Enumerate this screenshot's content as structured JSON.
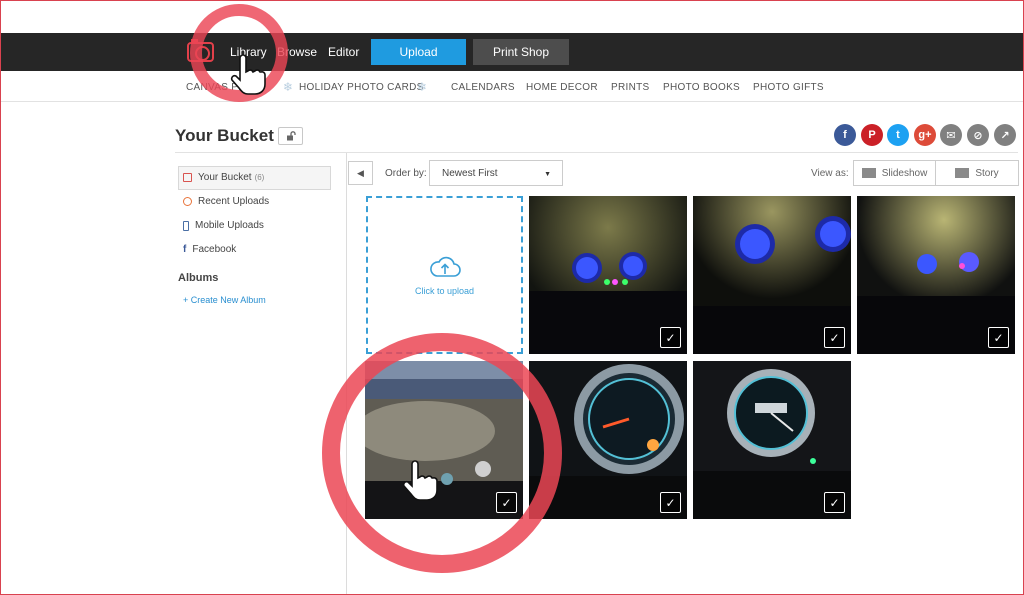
{
  "nav": {
    "items": [
      "Library",
      "Browse",
      "Editor"
    ],
    "upload_label": "Upload",
    "printshop_label": "Print Shop"
  },
  "subnav": {
    "canvas": "CANVAS PR",
    "holiday": "HOLIDAY PHOTO CARDS",
    "calendars": "CALENDARS",
    "home_decor": "HOME DECOR",
    "prints": "PRINTS",
    "photo_books": "PHOTO BOOKS",
    "photo_gifts": "PHOTO GIFTS"
  },
  "page": {
    "title": "Your Bucket"
  },
  "share": {
    "facebook": "f",
    "pinterest": "P",
    "twitter": "t",
    "googleplus": "g+",
    "email": "✉",
    "link": "⊘",
    "share": "↗"
  },
  "sidebar": {
    "items": [
      {
        "label": "Your Bucket",
        "count": "(6)"
      },
      {
        "label": "Recent Uploads"
      },
      {
        "label": "Mobile Uploads"
      },
      {
        "label": "Facebook"
      }
    ],
    "albums_title": "Albums",
    "create_album": "+ Create New Album"
  },
  "toolbar": {
    "order_label": "Order by:",
    "order_value": "Newest First",
    "viewas_label": "View as:",
    "slideshow_label": "Slideshow",
    "story_label": "Story"
  },
  "upload_tile": {
    "label": "Click to upload"
  },
  "colors": {
    "accent": "#1f9be0",
    "brand": "#e2404a",
    "topbar": "#262626",
    "highlight_ring": "#eb4655"
  }
}
